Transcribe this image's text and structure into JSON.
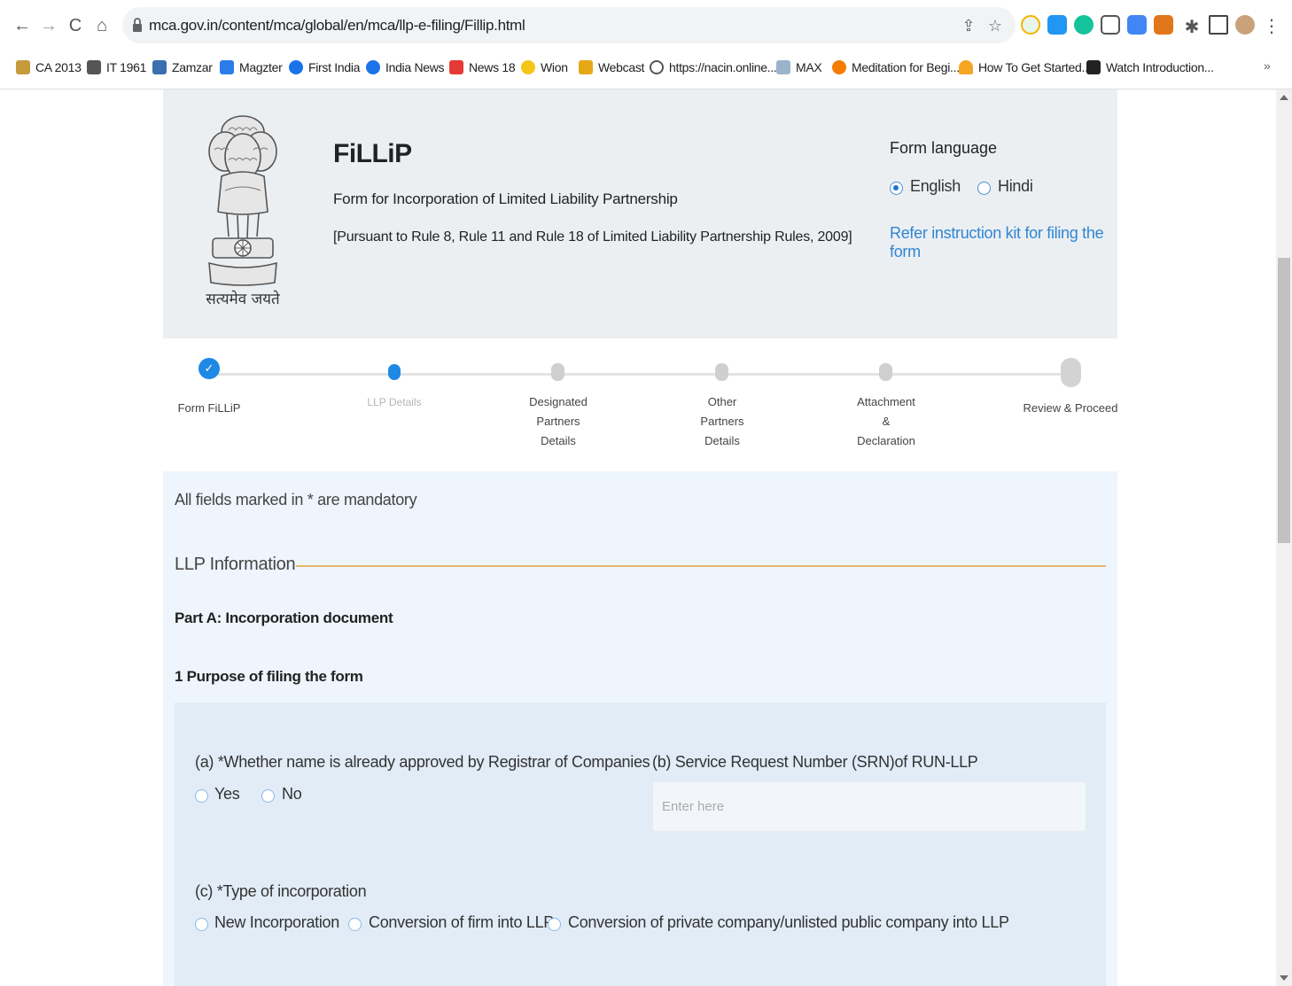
{
  "browser": {
    "url": "mca.gov.in/content/mca/global/en/mca/llp-e-filing/Fillip.html",
    "bookmarks": [
      "CA 2013",
      "IT 1961",
      "Zamzar",
      "Magzter",
      "First India",
      "India News",
      "News 18",
      "Wion",
      "Webcast",
      "https://nacin.online...",
      "MAX",
      "Meditation for Begi...",
      "How To Get Started...",
      "Watch Introduction..."
    ],
    "bookmarks_more": "»"
  },
  "header": {
    "emblem_caption": "सत्यमेव जयते",
    "title": "FiLLiP",
    "subtitle": "Form for Incorporation of Limited Liability Partnership",
    "rule_ref": "[Pursuant to Rule 8, Rule 11 and Rule 18 of Limited Liability Partnership Rules, 2009]",
    "form_language_label": "Form language",
    "language_options": [
      "English",
      "Hindi"
    ],
    "selected_language": "English",
    "instruction_link": "Refer instruction kit for filing the form"
  },
  "stepper": {
    "steps": [
      {
        "label": "Form FiLLiP",
        "state": "completed"
      },
      {
        "label": "LLP Details",
        "state": "current"
      },
      {
        "label": "Designated\nPartners\nDetails",
        "state": "pending"
      },
      {
        "label": "Other\nPartners\nDetails",
        "state": "pending"
      },
      {
        "label": "Attachment\n&\nDeclaration",
        "state": "pending"
      },
      {
        "label": "Review & Proceed",
        "state": "pending"
      }
    ],
    "check_mark": "✓"
  },
  "form": {
    "mandatory_note": "All fields marked in * are mandatory",
    "section_title": "LLP Information",
    "part_a": "Part A: Incorporation document",
    "purpose_title": "1 Purpose of filing the form",
    "q_a": {
      "label": "(a) *Whether name is already approved by Registrar of Companies",
      "options": [
        "Yes",
        "No"
      ]
    },
    "q_b": {
      "label": "(b) Service Request Number (SRN)of RUN-LLP",
      "placeholder": "Enter here",
      "value": ""
    },
    "q_c": {
      "label": "(c) *Type of incorporation",
      "options": [
        "New Incorporation",
        "Conversion of firm into LLP",
        "Conversion of private company/unlisted public company into LLP"
      ]
    }
  },
  "colors": {
    "accent": "#1976d2",
    "link": "#2f86d3",
    "section_rule": "#e8b86d",
    "header_bg": "#eceff2",
    "content_bg": "#eef5fc"
  }
}
